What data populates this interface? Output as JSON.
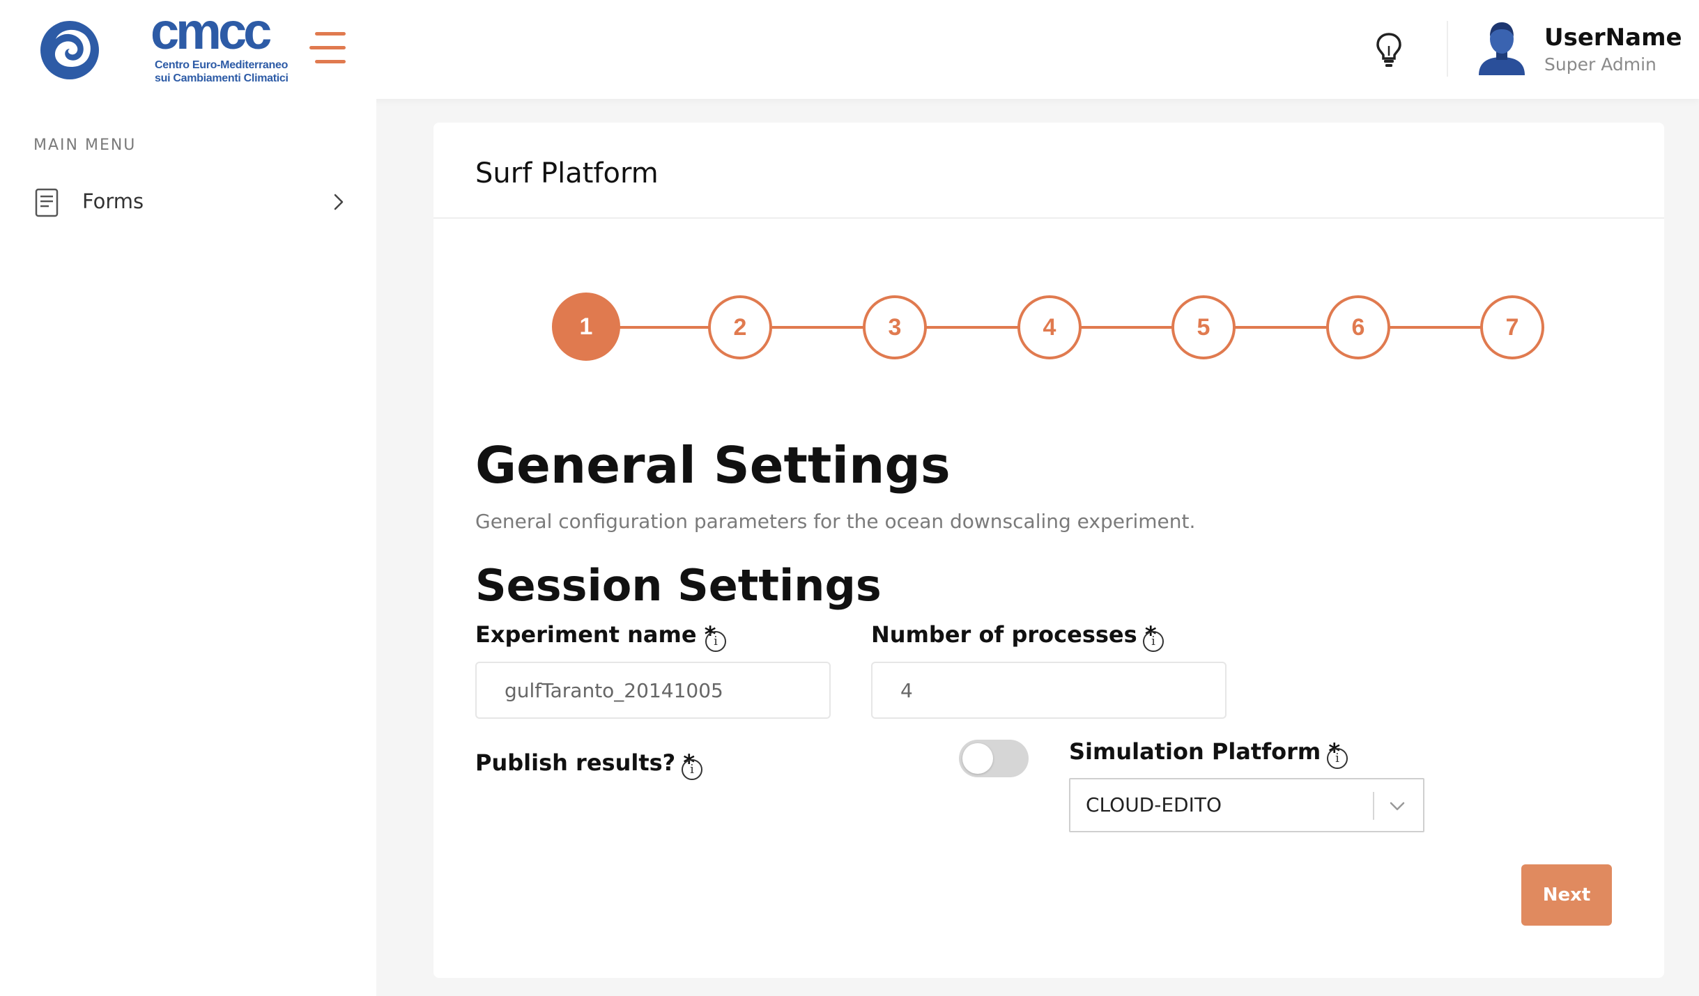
{
  "brand": {
    "logo_text": "cmcc",
    "subtitle_line1": "Centro Euro-Mediterraneo",
    "subtitle_line2": "sui Cambiamenti Climatici"
  },
  "header": {
    "menu_icon": "hamburger-icon",
    "tip_icon": "lightbulb-icon",
    "user": {
      "name": "UserName",
      "role": "Super Admin",
      "avatar_icon": "user-avatar-icon"
    }
  },
  "sidebar": {
    "title": "MAIN MENU",
    "items": [
      {
        "label": "Forms",
        "icon": "document-icon",
        "chevron": "chevron-right-icon"
      }
    ]
  },
  "card": {
    "title": "Surf Platform",
    "stepper": {
      "steps": [
        "1",
        "2",
        "3",
        "4",
        "5",
        "6",
        "7"
      ],
      "active_step": 1
    },
    "section_title": "General Settings",
    "section_description": "General configuration parameters for the ocean downscaling experiment.",
    "subsection_title": "Session Settings",
    "fields": {
      "experiment_name": {
        "label": "Experiment name *",
        "value": "gulfTaranto_20141005"
      },
      "num_processes": {
        "label": "Number of processes *",
        "value": "4"
      },
      "publish_results": {
        "label": "Publish results? *",
        "checked": false
      },
      "simulation_platform": {
        "label": "Simulation Platform *",
        "value": "CLOUD-EDITO"
      }
    },
    "info_glyph": "i",
    "next_label": "Next"
  },
  "colors": {
    "accent": "#e07a4f",
    "brand_blue": "#2d5ba6",
    "background": "#f5f5f5"
  }
}
